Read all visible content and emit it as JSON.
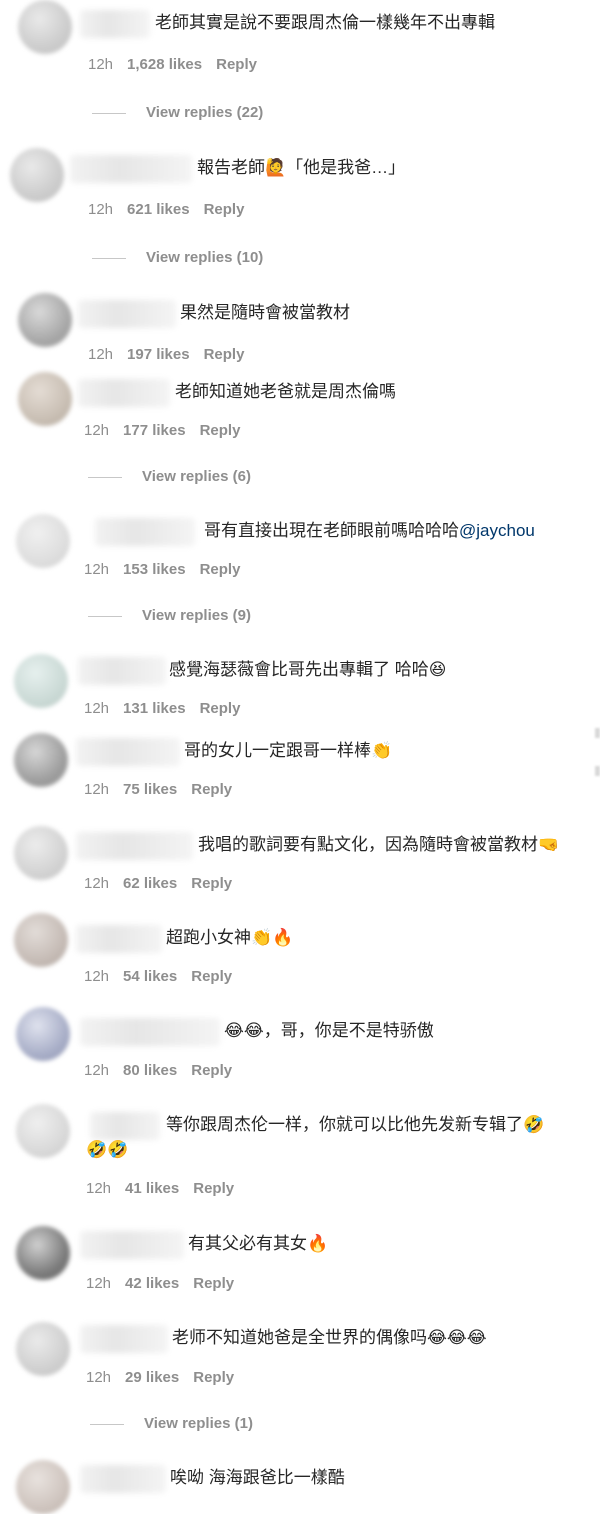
{
  "comments": [
    {
      "text": "老師其實是說不要跟周杰倫一樣幾年不出專輯",
      "time": "12h",
      "likes": "1,628 likes",
      "reply": "Reply",
      "view_replies": "View replies (22)"
    },
    {
      "text": "報告老師🙋「他是我爸…」",
      "time": "12h",
      "likes": "621 likes",
      "reply": "Reply",
      "view_replies": "View replies (10)"
    },
    {
      "text": "果然是隨時會被當教材",
      "time": "12h",
      "likes": "197 likes",
      "reply": "Reply"
    },
    {
      "text": "老師知道她老爸就是周杰倫嗎",
      "time": "12h",
      "likes": "177 likes",
      "reply": "Reply",
      "view_replies": "View replies (6)"
    },
    {
      "text": "哥有直接出現在老師眼前嗎哈哈哈",
      "mention": "@jaychou",
      "time": "12h",
      "likes": "153 likes",
      "reply": "Reply",
      "view_replies": "View replies (9)"
    },
    {
      "text": "感覺海瑟薇會比哥先出專輯了 哈哈😆",
      "time": "12h",
      "likes": "131 likes",
      "reply": "Reply"
    },
    {
      "text": "哥的女儿一定跟哥一样棒👏",
      "time": "12h",
      "likes": "75 likes",
      "reply": "Reply"
    },
    {
      "text": "我唱的歌詞要有點文化，因為隨時會被當教材🤜",
      "time": "12h",
      "likes": "62 likes",
      "reply": "Reply"
    },
    {
      "text": "超跑小女神👏🔥",
      "time": "12h",
      "likes": "54 likes",
      "reply": "Reply"
    },
    {
      "text": "😂😂，哥，你是不是特骄傲",
      "time": "12h",
      "likes": "80 likes",
      "reply": "Reply"
    },
    {
      "text": "等你跟周杰伦一样，你就可以比他先发新专辑了🤣",
      "text2": "🤣🤣",
      "time": "12h",
      "likes": "41 likes",
      "reply": "Reply"
    },
    {
      "text": "有其父必有其女🔥",
      "time": "12h",
      "likes": "42 likes",
      "reply": "Reply"
    },
    {
      "text": "老师不知道她爸是全世界的偶像吗😂😂😂",
      "time": "12h",
      "likes": "29 likes",
      "reply": "Reply",
      "view_replies": "View replies (1)"
    },
    {
      "text": "唉呦 海海跟爸比一樣酷"
    }
  ]
}
